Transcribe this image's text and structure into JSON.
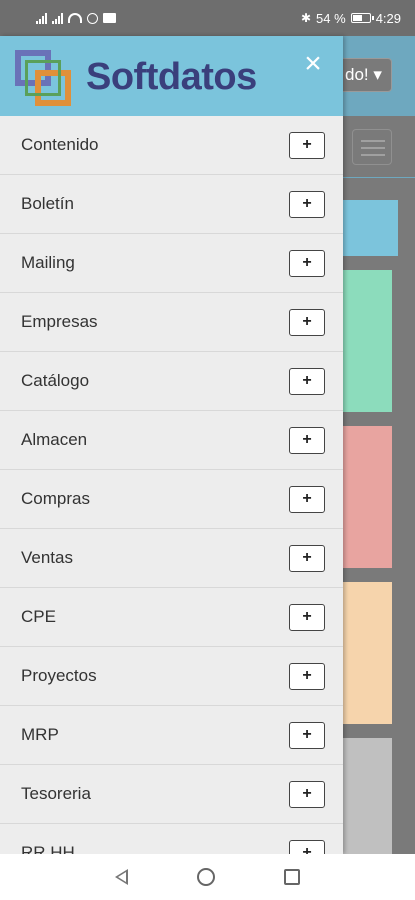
{
  "status_bar": {
    "battery_percent": "54 %",
    "time": "4:29",
    "icons": [
      "signal-icon",
      "signal-icon",
      "wifi-icon",
      "alarm-icon",
      "mail-icon",
      "bluetooth-icon",
      "battery-icon"
    ]
  },
  "background": {
    "greeting_partial": "do! ▾",
    "card_colors": [
      "#7cc4dc",
      "#8cdcbc",
      "#e8a4a0",
      "#f6d4ac",
      "#c0c0c0"
    ]
  },
  "drawer": {
    "brand": "Softdatos",
    "logo_colors": [
      "#6a72b8",
      "#e0903a",
      "#5aa05a"
    ],
    "close_label": "×",
    "expand_label": "+",
    "items": [
      {
        "label": "Contenido"
      },
      {
        "label": "Boletín"
      },
      {
        "label": "Mailing"
      },
      {
        "label": "Empresas"
      },
      {
        "label": "Catálogo"
      },
      {
        "label": "Almacen"
      },
      {
        "label": "Compras"
      },
      {
        "label": "Ventas"
      },
      {
        "label": "CPE"
      },
      {
        "label": "Proyectos"
      },
      {
        "label": "MRP"
      },
      {
        "label": "Tesoreria"
      },
      {
        "label": "RR.HH."
      }
    ]
  }
}
